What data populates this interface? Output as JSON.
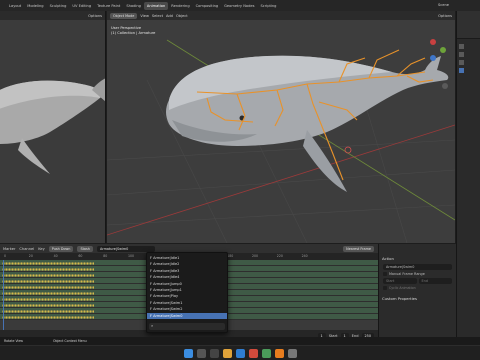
{
  "app": {
    "menus": [
      "Layout",
      "Modeling",
      "Sculpting",
      "UV Editing",
      "Texture Paint",
      "Shading",
      "Animation",
      "Rendering",
      "Compositing",
      "Geometry Nodes",
      "Scripting"
    ],
    "active_workspace": "Animation",
    "scene_label": "Scene"
  },
  "viewport": {
    "mode": "Object Mode",
    "menus": [
      "View",
      "Select",
      "Add",
      "Object"
    ],
    "perspective": "User Perspective",
    "collection": "(1) Collection | Armature",
    "options": "Options"
  },
  "left_viewport": {
    "options": "Options"
  },
  "dopesheet": {
    "menus": [
      "Marker",
      "Channel",
      "Key"
    ],
    "push_down": "Push Down",
    "stash": "Stash",
    "action_name": "Armature|Swim0",
    "nearest_frame": "Nearest Frame",
    "frame_ticks": [
      "0",
      "20",
      "40",
      "60",
      "80",
      "100",
      "120",
      "140",
      "160",
      "180",
      "200",
      "220",
      "240"
    ],
    "track_count": 10
  },
  "popup": {
    "items": [
      "Armature|Idle1",
      "Armature|Idle2",
      "Armature|Idle3",
      "Armature|Idle4",
      "Armature|Jump0",
      "Armature|Jump1",
      "Armature|Play",
      "Armature|Swim1",
      "Armature|Swim2",
      "Armature|Swim0"
    ],
    "selected_index": 9,
    "search_placeholder": ""
  },
  "action_panel": {
    "action_header": "Action",
    "action_field": "Armature|Swim0",
    "manual_range_label": "Manual Frame Range",
    "start_label": "Start",
    "end_label": "End",
    "cyclic_label": "Cyclic Animation",
    "custom_properties": "Custom Properties"
  },
  "playback": {
    "start_label": "Start",
    "start_value": "1",
    "end_label": "End",
    "end_value": "250",
    "current_frame": "1"
  },
  "statusbar": {
    "left": "Rotate View",
    "middle": "Object Context Menu"
  },
  "colors": {
    "bone": "#e8922a",
    "selection": "#4772b3",
    "key_yellow": "#d6b84a",
    "track_green": "#3f5a46"
  }
}
